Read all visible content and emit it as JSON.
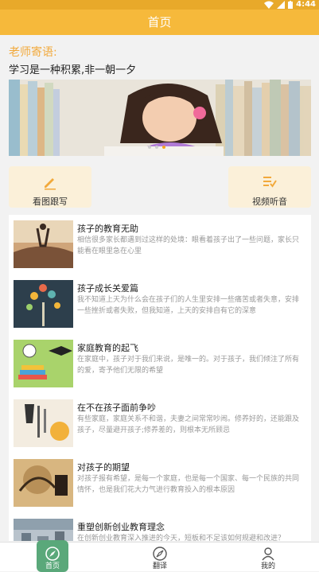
{
  "status_bar": {
    "time": "4:44"
  },
  "app_bar": {
    "title": "首页"
  },
  "teacher": {
    "label": "老师寄语:",
    "motto": "学习是一种积累,非一朝一夕"
  },
  "banner": {
    "page_count": 3,
    "active_index": 2
  },
  "tiles": [
    {
      "label": "看图跟写",
      "icon": "pencil-icon"
    },
    {
      "label": "视频听音",
      "icon": "check-list-icon"
    }
  ],
  "articles": [
    {
      "title": "孩子的教育无助",
      "desc": "相信很多家长都遇到过这样的处境：眼看着孩子出了一些问题，家长只能看在眼里急在心里"
    },
    {
      "title": "孩子成长关爱篇",
      "desc": "我不知道上天为什么会在孩子们的人生里安排一些痛苦或者失意，安排一些挫折或者失败，但我知道，上天的安排自有它的深意"
    },
    {
      "title": "家庭教育的起飞",
      "desc": "在家庭中，孩子对于我们来说，是唯一的。对于孩子，我们倾注了所有的爱，寄予他们无限的希望"
    },
    {
      "title": "在不在孩子面前争吵",
      "desc": "有些家庭，家庭关系不和谐，夫妻之间常常吵闹。修养好的，还能跟及孩子，尽量避开孩子;修养差的，则根本无所顾忌"
    },
    {
      "title": "对孩子的期望",
      "desc": "对孩子报有希望，是每一个家庭，也是每一个国家、每一个民族的共同情怀，也是我们花大力气进行教育投入的根本原因"
    },
    {
      "title": "重塑创新创业教育理念",
      "desc": "在创新创业教育深入推进的今天，短板和不足该如何规避和改进？"
    }
  ],
  "bottom_nav": [
    {
      "label": "首页",
      "icon": "home-compass-icon",
      "active": true
    },
    {
      "label": "翻译",
      "icon": "compass-icon",
      "active": false
    },
    {
      "label": "我的",
      "icon": "user-icon",
      "active": false
    }
  ],
  "colors": {
    "accent": "#f6b93b",
    "status_bar": "#e8a92a",
    "nav_active": "#5aa87a"
  }
}
